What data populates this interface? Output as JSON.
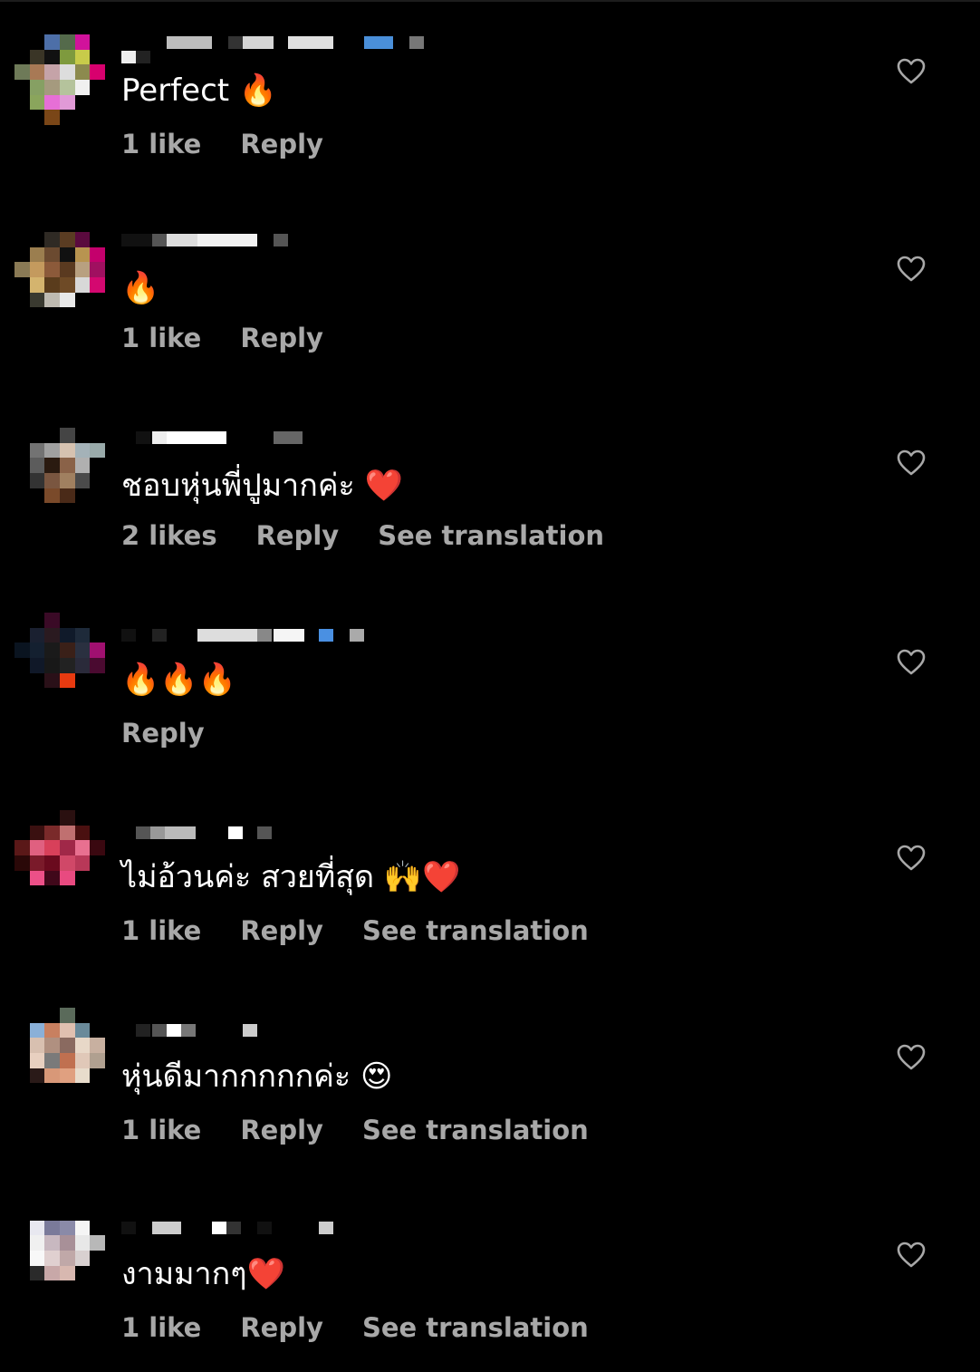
{
  "comments": [
    {
      "text": "Perfect 🔥",
      "likes": "1 like",
      "reply": "Reply",
      "translate": ""
    },
    {
      "text": "🔥",
      "likes": "1 like",
      "reply": "Reply",
      "translate": ""
    },
    {
      "text": "ชอบหุ่นพี่ปูมากค่ะ ❤️",
      "likes": "2 likes",
      "reply": "Reply",
      "translate": "See translation"
    },
    {
      "text": "🔥🔥🔥",
      "likes": "",
      "reply": "Reply",
      "translate": ""
    },
    {
      "text": "ไม่อ้วนค่ะ สวยที่สุด 🙌❤️",
      "likes": "1 like",
      "reply": "Reply",
      "translate": "See translation"
    },
    {
      "text": "หุ่นดีมากกกกกค่ะ 😍",
      "likes": "1 like",
      "reply": "Reply",
      "translate": "See translation"
    },
    {
      "text": "งามมากๆ❤️",
      "likes": "1 like",
      "reply": "Reply",
      "translate": "See translation"
    }
  ],
  "colors": {
    "background": "#000000",
    "text": "#ffffff",
    "secondary_text": "#a8a8a8"
  },
  "icons": {
    "like": "heart-outline-icon"
  }
}
